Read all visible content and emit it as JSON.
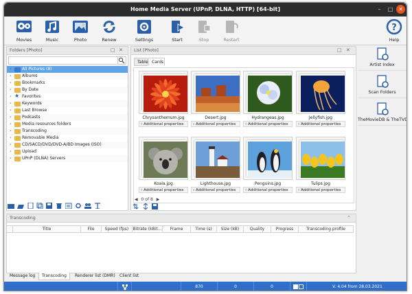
{
  "window": {
    "title": "Home Media Server (UPnP, DLNA, HTTP) [64-bit]"
  },
  "toolbar": [
    {
      "label": "Movies",
      "icon": "movies-icon",
      "enabled": true
    },
    {
      "label": "Music",
      "icon": "music-icon",
      "enabled": true
    },
    {
      "label": "Photo",
      "icon": "photo-icon",
      "enabled": true
    },
    {
      "label": "Renew",
      "icon": "renew-icon",
      "enabled": true
    },
    {
      "label": "Settings",
      "icon": "settings-icon",
      "enabled": true
    },
    {
      "label": "Start",
      "icon": "start-icon",
      "enabled": true
    },
    {
      "label": "Stop",
      "icon": "stop-icon",
      "enabled": false
    },
    {
      "label": "Restart",
      "icon": "restart-icon",
      "enabled": false
    },
    {
      "label": "Help",
      "icon": "help-icon",
      "enabled": true
    }
  ],
  "folders": {
    "title": "Folders [Photo]",
    "search_value": "",
    "items": [
      {
        "label": "All Pictures (8)",
        "selected": true,
        "icon": "folder-blue"
      },
      {
        "label": "Albums",
        "icon": "folder"
      },
      {
        "label": "Bookmarks",
        "icon": "folder"
      },
      {
        "label": "By Date",
        "icon": "folder"
      },
      {
        "label": "Favorites",
        "icon": "star"
      },
      {
        "label": "Keywords",
        "icon": "folder"
      },
      {
        "label": "Last Browse",
        "icon": "folder"
      },
      {
        "label": "Podcasts",
        "icon": "folder"
      },
      {
        "label": "Media resources folders",
        "icon": "folder"
      },
      {
        "label": "Transcoding",
        "icon": "folder"
      },
      {
        "label": "Removable Media",
        "icon": "folder"
      },
      {
        "label": "CD/SACD/DVD/DVD-A/BD Images (ISO)",
        "icon": "folder"
      },
      {
        "label": "Upload",
        "icon": "folder"
      },
      {
        "label": "UPnP (DLNA) Servers",
        "icon": "folder"
      }
    ]
  },
  "list": {
    "title": "List [Photo]",
    "tabs": [
      "Table",
      "Cards"
    ],
    "active_tab": "Cards",
    "props_label": "Additional properties",
    "cards": [
      {
        "name": "Chrysanthemum.jpg",
        "theme": "chrysanthemum"
      },
      {
        "name": "Desert.jpg",
        "theme": "desert"
      },
      {
        "name": "Hydrangeas.jpg",
        "theme": "hydrangeas"
      },
      {
        "name": "Jellyfish.jpg",
        "theme": "jellyfish"
      },
      {
        "name": "Koala.jpg",
        "theme": "koala"
      },
      {
        "name": "Lighthouse.jpg",
        "theme": "lighthouse"
      },
      {
        "name": "Penguins.jpg",
        "theme": "penguins"
      },
      {
        "name": "Tulips.jpg",
        "theme": "tulips"
      }
    ],
    "pager": "0 of 8"
  },
  "side": [
    {
      "label": "Artist Index"
    },
    {
      "label": "Scan Folders"
    },
    {
      "label": "TheMovieDB & TheTVDB"
    }
  ],
  "transcoding": {
    "title": "Transcoding",
    "columns": [
      "Title",
      "File",
      "Speed (fps)",
      "Bitrate (kBit...",
      "Frame",
      "Time (s)",
      "Size (kB)",
      "Quality",
      "Progress",
      "Transcoding profile"
    ]
  },
  "bottom_tabs": [
    "Message log",
    "Transcoding",
    "Renderer list (DMR)",
    "Client list"
  ],
  "active_bottom_tab": "Transcoding",
  "status": {
    "count1": "870",
    "count2": "0",
    "count3": "0",
    "version": "V. 4.04 from 28.03.2021"
  },
  "colors": {
    "accent": "#2f6fc9",
    "selection": "#5ea3e6",
    "titlebar": "#2c2c2c",
    "close": "#e95420"
  }
}
